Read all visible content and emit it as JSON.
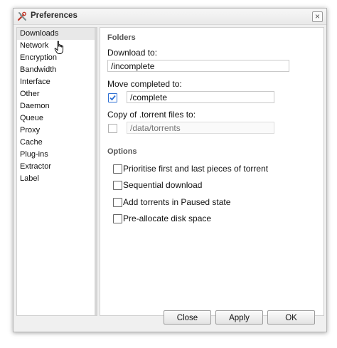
{
  "window": {
    "title": "Preferences",
    "close_symbol": "×"
  },
  "sidebar": {
    "items": [
      {
        "label": "Downloads",
        "selected": true
      },
      {
        "label": "Network"
      },
      {
        "label": "Encryption"
      },
      {
        "label": "Bandwidth"
      },
      {
        "label": "Interface"
      },
      {
        "label": "Other"
      },
      {
        "label": "Daemon"
      },
      {
        "label": "Queue"
      },
      {
        "label": "Proxy"
      },
      {
        "label": "Cache"
      },
      {
        "label": "Plug-ins"
      },
      {
        "label": "Extractor"
      },
      {
        "label": "Label"
      }
    ]
  },
  "folders": {
    "heading": "Folders",
    "download_to_label": "Download to:",
    "download_to_value": "/incomplete",
    "move_completed_label": "Move completed to:",
    "move_completed_value": "/complete",
    "move_completed_checked": true,
    "copy_torrent_label": "Copy of .torrent files to:",
    "copy_torrent_placeholder": "/data/torrents",
    "copy_torrent_checked": false
  },
  "options": {
    "heading": "Options",
    "items": [
      {
        "label": "Prioritise first and last pieces of torrent",
        "checked": false
      },
      {
        "label": "Sequential download",
        "checked": false
      },
      {
        "label": "Add torrents in Paused state",
        "checked": false
      },
      {
        "label": "Pre-allocate disk space",
        "checked": false
      }
    ]
  },
  "footer": {
    "close_label": "Close",
    "apply_label": "Apply",
    "ok_label": "OK"
  }
}
